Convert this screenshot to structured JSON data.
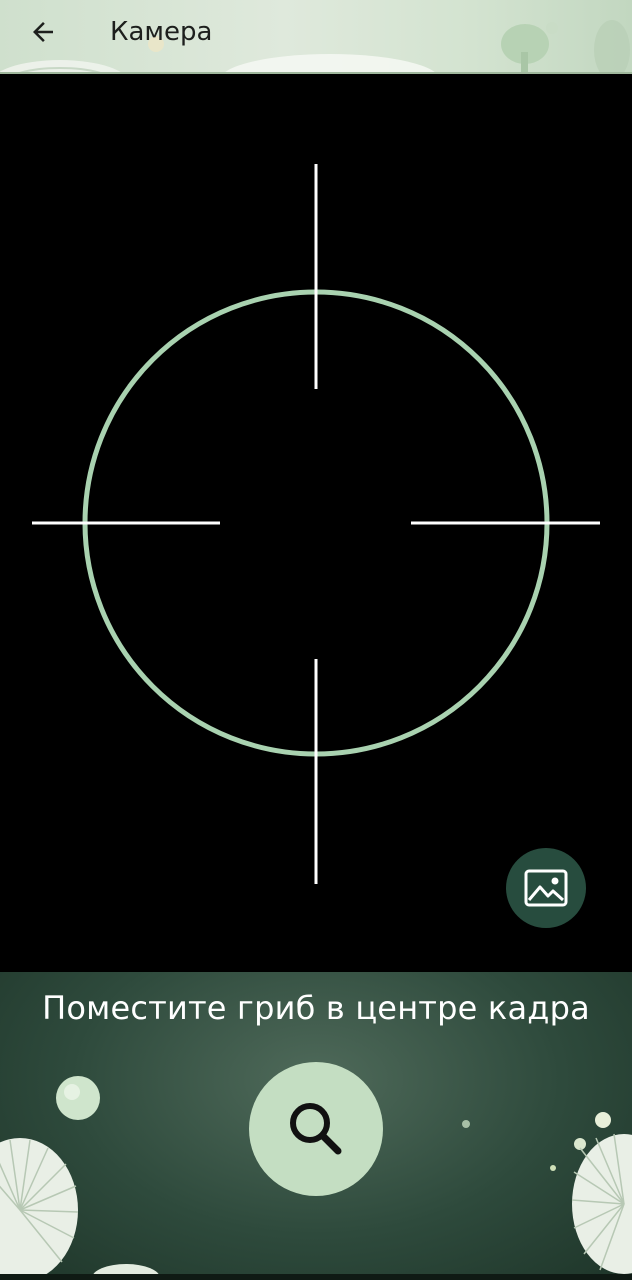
{
  "app_bar": {
    "title": "Камера",
    "back_icon": "arrow-back-icon"
  },
  "viewport": {
    "reticle_color": "#a9d2b0",
    "crosshair_color": "#ffffff",
    "gallery_icon": "image-gallery-icon"
  },
  "bottom": {
    "hint": "Поместите гриб в центре кадра",
    "scan_icon": "search-icon"
  },
  "colors": {
    "accent": "#c4dec2",
    "gallery_button": "#274c3e",
    "app_bar": "#d8e6d5"
  }
}
